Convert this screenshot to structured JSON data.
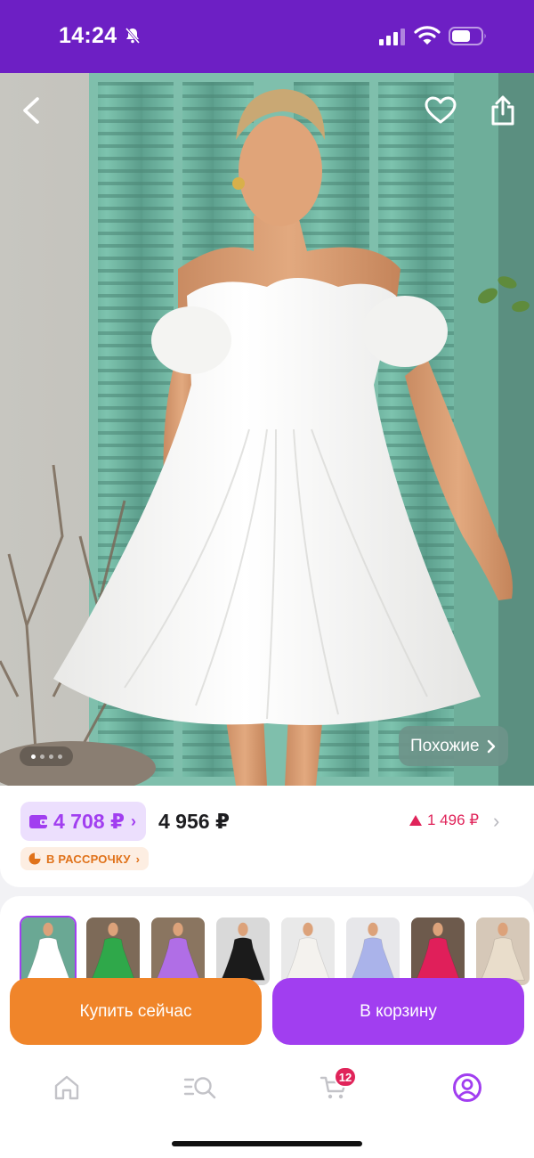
{
  "status_bar": {
    "time": "14:24",
    "icons": [
      "bell-off-icon",
      "signal-icon",
      "wifi-icon",
      "battery-icon"
    ]
  },
  "hero": {
    "image": "product-photo-white-dress",
    "icons": [
      "back-icon",
      "heart-icon",
      "share-icon"
    ],
    "gallery": {
      "total": 4,
      "active": 1
    },
    "similar_label": "Похожие"
  },
  "price": {
    "wallet_price": "4 708 ₽",
    "regular_price": "4 956 ₽",
    "discount": "1 496 ₽",
    "installment_label": "В РАССРОЧКУ",
    "colors": {
      "wallet_bg": "#ecdffd",
      "wallet_text": "#a13ef0",
      "discount": "#e0245a",
      "installment": "#e0721a"
    }
  },
  "variants": [
    {
      "color": "#ffffff",
      "selected": true
    },
    {
      "color": "#2fa84a",
      "selected": false
    },
    {
      "color": "#b06ee6",
      "selected": false
    },
    {
      "color": "#1b1b1b",
      "selected": false
    },
    {
      "color": "#f4f2ee",
      "selected": false
    },
    {
      "color": "#aab3ea",
      "selected": false
    },
    {
      "color": "#e01f5a",
      "selected": false
    },
    {
      "color": "#e9ddcb",
      "selected": false
    }
  ],
  "actions": {
    "buy_now": "Купить сейчас",
    "add_to_cart": "В корзину",
    "colors": {
      "buy_now": "#f0852a",
      "add_to_cart": "#a13ef0"
    }
  },
  "tab_bar": {
    "tabs": [
      "home-icon",
      "catalog-search-icon",
      "cart-icon",
      "profile-icon"
    ],
    "cart_badge": "12",
    "active_tab": "profile"
  },
  "theme": {
    "brand": "#6d1fc4",
    "accent": "#a13ef0"
  }
}
